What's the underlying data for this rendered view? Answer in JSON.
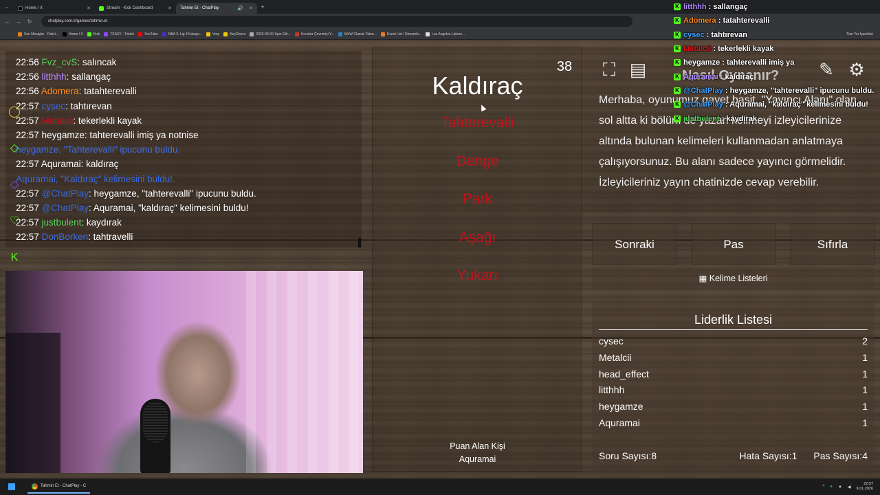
{
  "browser": {
    "tabs": [
      {
        "label": "Home / X",
        "color": "#000000",
        "active": false
      },
      {
        "label": "Stream - Kick Dashboard",
        "color": "#53fc18",
        "active": false
      },
      {
        "label": "Tahmin Et - ChatPlay",
        "color": "#444444",
        "active": true
      }
    ],
    "url": "chatplay.com.tr/games/tahmin.et",
    "bookmarks": [
      "Son Mesajlar - Patici...",
      "Home / X",
      "Kick",
      "TEASY - Twitch",
      "YouTube",
      "NBA 3. Lig 8 Katego...",
      "Vorp",
      "KeyGivers",
      "2025-09-06 Spor Etk...",
      "Ücretsiz Çevrimiçi Y...",
      "WoW Classic Talon...",
      "Event List / Streamla...",
      "Los Angeles Lakers..."
    ],
    "bookmarks_right": "Tüm Yer İşaretleri"
  },
  "chat": [
    {
      "time": "22:56",
      "user": "Fvz_cvS",
      "color": "#5ad45a",
      "text": "salıncak",
      "type": "msg"
    },
    {
      "time": "22:56",
      "user": "litthhh",
      "color": "#b48cff",
      "text": "sallangaç",
      "type": "msg"
    },
    {
      "time": "22:56",
      "user": "Adomera",
      "color": "#ff8c1a",
      "text": "tatahterevalli",
      "type": "msg"
    },
    {
      "time": "22:57",
      "user": "cysec",
      "color": "#3a6be0",
      "text": "tahtırevan",
      "type": "msg"
    },
    {
      "time": "22:57",
      "user": "Metalcii",
      "color": "#c0141c",
      "text": "tekerlekli kayak",
      "type": "msg"
    },
    {
      "time": "22:57",
      "user": "heygamze",
      "color": "#ffffff",
      "text": "tahterevalli imiş ya notnise",
      "type": "msg"
    },
    {
      "text": "heygamze, \"Tahterevalli\" ipucunu buldu.",
      "type": "sys"
    },
    {
      "time": "22:57",
      "user": "Aquramai",
      "color": "#ffffff",
      "text": "kaldıraç",
      "type": "msg"
    },
    {
      "text": "Aquramai, \"Kaldıraç\" kelimesini buldu!.",
      "type": "sys"
    },
    {
      "time": "22:57",
      "user": "@ChatPlay",
      "color": "#3a6be0",
      "text": "heygamze, \"tahterevalli\" ipucunu buldu.",
      "type": "msg"
    },
    {
      "time": "22:57",
      "user": "@ChatPlay",
      "color": "#3a6be0",
      "text": "Aquramai, \"kaldıraç\" kelimesini buldu!",
      "type": "msg"
    },
    {
      "time": "22:57",
      "user": "justbulent",
      "color": "#5ad45a",
      "text": "kaydırak",
      "type": "msg"
    },
    {
      "time": "22:57",
      "user": "DonBorken",
      "color": "#3a6be0",
      "text": "tahtravelli",
      "type": "msg"
    }
  ],
  "game": {
    "word": "Kaldıraç",
    "timer": "38",
    "taboo": [
      "Tahterevalli",
      "Denge",
      "Park",
      "Aşağı",
      "Yukarı"
    ],
    "scorer_label": "Puan Alan Kişi",
    "scorer_name": "Aquramai"
  },
  "info": {
    "title": "Nasıl Oynanır?",
    "text": "Merhaba, oyunumuz gayet basit. \"Yayıncı Alanı\" olan sol altta ki bölüm de yazan kelimeyi izleyicilerinize altında bulunan kelimeleri kullanmadan anlatmaya çalışıyorsunuz. Bu alanı sadece yayıncı görmelidir. İzleyicileriniz yayın chatinizde cevap verebilir."
  },
  "buttons": {
    "next": "Sonraki",
    "pass": "Pas",
    "reset": "Sıfırla",
    "word_lists": "Kelime Listeleri"
  },
  "leaderboard": {
    "title": "Liderlik Listesi",
    "rows": [
      {
        "name": "cysec",
        "score": "2"
      },
      {
        "name": "Metalcii",
        "score": "1"
      },
      {
        "name": "head_effect",
        "score": "1"
      },
      {
        "name": "litthhh",
        "score": "1"
      },
      {
        "name": "heygamze",
        "score": "1"
      },
      {
        "name": "Aquramai",
        "score": "1"
      }
    ]
  },
  "stats": {
    "questions": "Soru Sayısı:8",
    "errors": "Hata Sayısı:1",
    "passes": "Pas Sayısı:4"
  },
  "overlay_chat": [
    {
      "user": "litthhh",
      "color": "#b48cff",
      "text": "sallangaç"
    },
    {
      "user": "Adomera",
      "color": "#ff8c1a",
      "text": "tatahterevalli"
    },
    {
      "user": "cysec",
      "color": "#3aa0ff",
      "text": "tahtırevan"
    },
    {
      "user": "Metalcii",
      "color": "#e0141c",
      "text": "tekerlekli kayak"
    },
    {
      "user": "heygamze",
      "color": "#ffffff",
      "text": "tahterevalli imiş ya"
    },
    {
      "user": "Aquramai",
      "color": "#b48cff",
      "text": "kaldıraç"
    },
    {
      "user": "@ChatPlay",
      "color": "#3aa0ff",
      "text": "heygamze, \"tahterevalli\" ipucunu buldu."
    },
    {
      "user": "@ChatPlay",
      "color": "#3aa0ff",
      "text": "Aquramai, \"kaldıraç\" kelimesini buldu!"
    },
    {
      "user": "justbulent",
      "color": "#5ad45a",
      "text": "kaydırak"
    }
  ],
  "taskbar": {
    "app": "Tahmin Et - ChatPlay - C",
    "time": "22:57",
    "date": "9.01.2026"
  }
}
